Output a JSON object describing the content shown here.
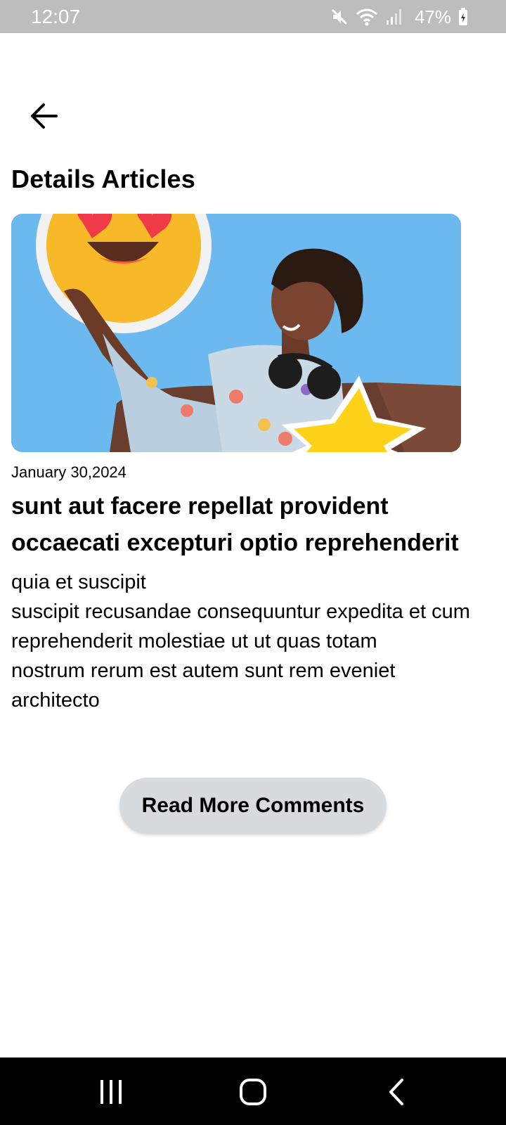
{
  "status_bar": {
    "time": "12:07",
    "battery": "47%",
    "icons": [
      "mute-icon",
      "wifi-icon",
      "signal-icon",
      "battery-icon"
    ]
  },
  "header": {
    "back_icon": "arrow-left-icon",
    "title": "Details Articles"
  },
  "article": {
    "image_alt": "Smiling woman holding heart-eyes emoji sign with star sticker",
    "date": "January 30,2024",
    "title": "sunt aut facere repellat provident occaecati excepturi optio reprehenderit",
    "body": "quia et suscipit\nsuscipit recusandae consequuntur expedita et cum\nreprehenderit molestiae ut ut quas totam\nnostrum rerum est autem sunt rem eveniet architecto"
  },
  "actions": {
    "read_more_label": "Read More Comments"
  },
  "nav_bar": {
    "icons": [
      "recent-apps-icon",
      "home-icon",
      "back-icon"
    ]
  },
  "colors": {
    "status_bar": "#bdbdbd",
    "image_bg": "#6bb9ee",
    "button_bg": "#d7dbde",
    "nav_bar": "#000000"
  }
}
